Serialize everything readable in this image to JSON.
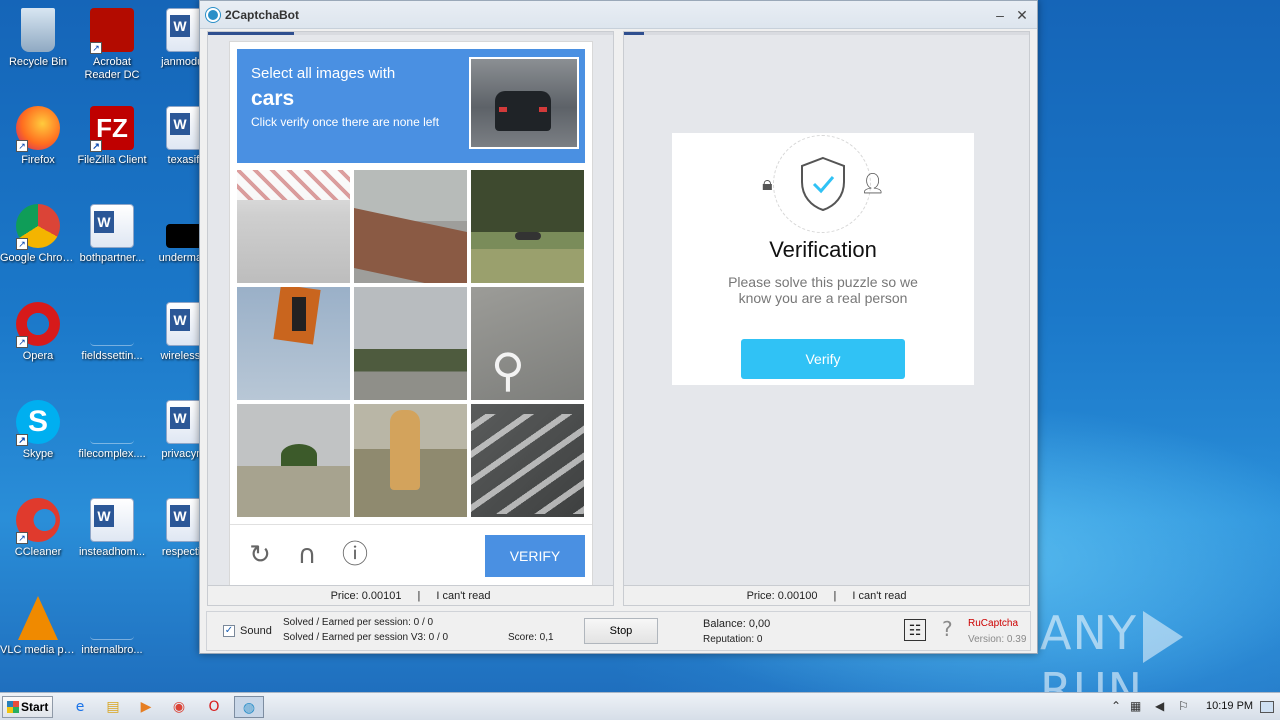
{
  "desktop": {
    "icons": [
      {
        "label": "Recycle Bin"
      },
      {
        "label": "Acrobat Reader DC"
      },
      {
        "label": "janmodul..."
      },
      {
        "label": "Firefox"
      },
      {
        "label": "FileZilla Client"
      },
      {
        "label": "texasif..."
      },
      {
        "label": "Google Chrome"
      },
      {
        "label": "bothpartner..."
      },
      {
        "label": "underman..."
      },
      {
        "label": "Opera"
      },
      {
        "label": "fieldssettin..."
      },
      {
        "label": "wirelessn..."
      },
      {
        "label": "Skype"
      },
      {
        "label": "filecomplex...."
      },
      {
        "label": "privacym..."
      },
      {
        "label": "CCleaner"
      },
      {
        "label": "insteadhom..."
      },
      {
        "label": "respectiv..."
      },
      {
        "label": "VLC media player"
      },
      {
        "label": "internalbro..."
      }
    ],
    "watermark": "ANY RUN"
  },
  "window": {
    "title": "2CaptchaBot",
    "minimize": "–",
    "close": "✕"
  },
  "left_panel": {
    "captcha": {
      "instruction": "Select all images with",
      "target": "cars",
      "hint": "Click verify once there are none left",
      "verify_label": "VERIFY",
      "refresh_icon": "↻",
      "audio_icon": "∩",
      "info_icon": "ⓘ"
    },
    "price": "Price: 0.00101",
    "separator": "|",
    "cant_read": "I can't read"
  },
  "right_panel": {
    "card": {
      "title": "Verification",
      "text": "Please solve this puzzle so we know you are a real person",
      "button": "Verify"
    },
    "price": "Price: 0.00100",
    "separator": "|",
    "cant_read": "I can't read"
  },
  "status": {
    "sound_checked": "✓",
    "sound_label": "Sound",
    "solved": "Solved / Earned per session: 0 / 0",
    "solved_v3": "Solved / Earned per session V3: 0 / 0",
    "score": "Score: 0,1",
    "stop": "Stop",
    "balance": "Balance:  0,00",
    "reputation": "Reputation: 0",
    "settings_icon": "☷",
    "help_icon": "?",
    "ru": "RuCaptcha",
    "version": "Version: 0.39"
  },
  "taskbar": {
    "start": "Start",
    "clock": "10:19 PM"
  }
}
